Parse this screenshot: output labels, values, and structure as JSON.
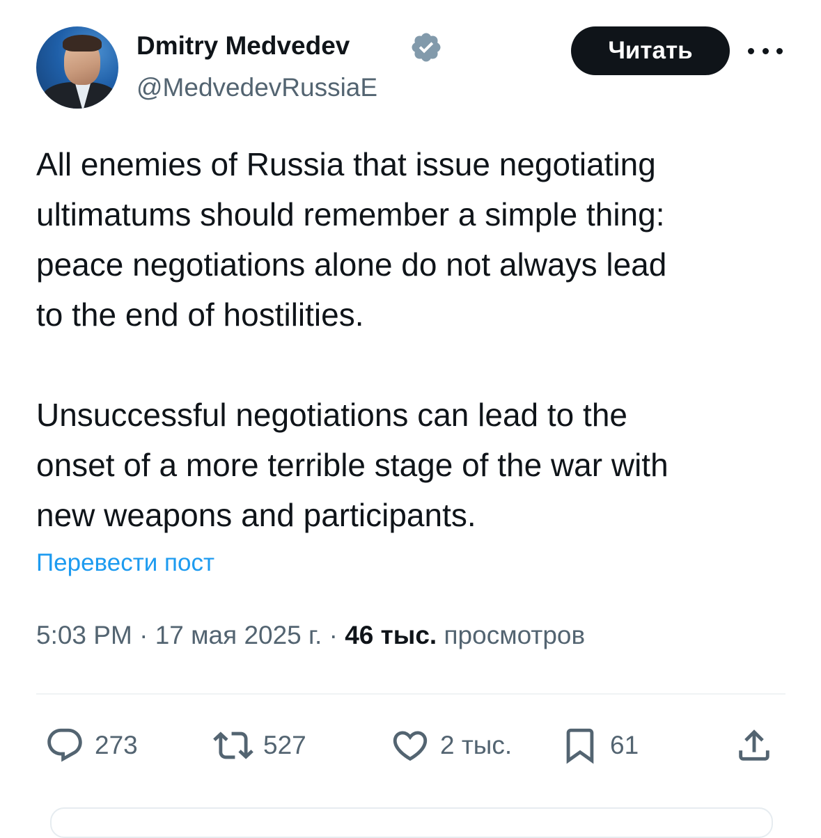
{
  "author": {
    "display_name": "Dmitry Medvedev",
    "handle": "@MedvedevRussiaE",
    "verified": true
  },
  "follow_button_label": "Читать",
  "more_icon": "ellipsis-icon",
  "tweet": {
    "paragraphs": [
      "All enemies of Russia that issue negotiating\nultimatums should remember a simple thing:\npeace negotiations alone do not always lead\nto the end of hostilities.",
      "Unsuccessful negotiations can lead to the\nonset of a more terrible stage of the war with\nnew weapons and participants."
    ],
    "translate_label": "Перевести пост"
  },
  "meta": {
    "time": "5:03 PM",
    "separator": " · ",
    "date": "17 мая 2025 г.",
    "views_count": "46 тыс.",
    "views_label": " просмотров"
  },
  "actions": {
    "replies": "273",
    "reposts": "527",
    "likes": "2 тыс.",
    "bookmarks": "61"
  },
  "colors": {
    "text": "#0f1419",
    "secondary": "#536471",
    "link": "#1d9bf0",
    "verified": "#829aab"
  }
}
